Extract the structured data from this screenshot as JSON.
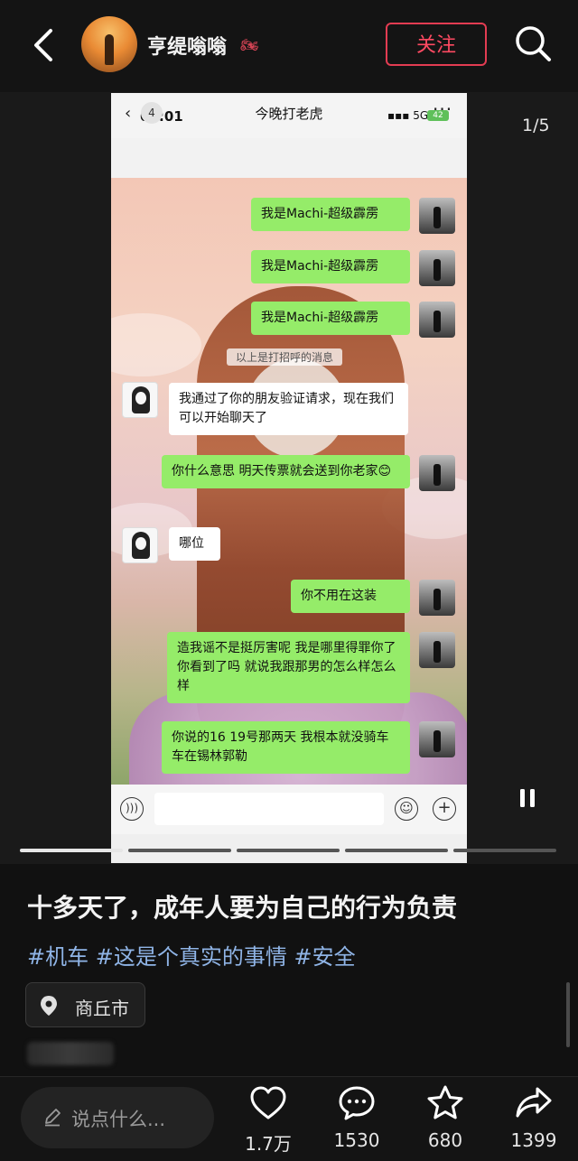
{
  "header": {
    "username": "亨缇嗡嗡",
    "username_emoji": "🏍",
    "follow_label": "关注"
  },
  "media": {
    "page_indicator": "1/5",
    "progress": {
      "total_segments": 5,
      "active_index": 0
    }
  },
  "screenshot": {
    "status_time": "09:01",
    "signal_text": "5G",
    "battery": "42",
    "chat_back_count": "4",
    "chat_title": "今晚打老虎",
    "chat_more": "···",
    "system_message": "以上是打招呼的消息",
    "messages": [
      {
        "side": "right",
        "text": "我是Machi-超级霹雳"
      },
      {
        "side": "right",
        "text": "我是Machi-超级霹雳"
      },
      {
        "side": "right",
        "text": "我是Machi-超级霹雳"
      },
      {
        "side": "left",
        "text": "我通过了你的朋友验证请求，现在我们可以开始聊天了"
      },
      {
        "side": "right",
        "text": "你什么意思  明天传票就会送到你老家😊"
      },
      {
        "side": "left",
        "text": "哪位"
      },
      {
        "side": "right",
        "text": "你不用在这装"
      },
      {
        "side": "right",
        "text": "造我谣不是挺厉害呢   我是哪里得罪你了  你看到了吗 就说我跟那男的怎么样怎么样"
      },
      {
        "side": "right",
        "text": "你说的16  19号那两天  我根本就没骑车  车在锡林郭勒"
      }
    ]
  },
  "post": {
    "title": "十多天了，成年人要为自己的行为负责",
    "tags": "#机车 #这是个真实的事情 #安全",
    "location": "商丘市"
  },
  "bottom": {
    "comment_placeholder": "说点什么...",
    "likes": "1.7万",
    "comments": "1530",
    "stars": "680",
    "shares": "1399"
  },
  "colors": {
    "follow_accent": "#e33c52",
    "tag_blue": "#8fb4e6",
    "bubble_green": "#95ec69"
  },
  "icons": [
    "back-arrow-icon",
    "search-icon",
    "pause-icon",
    "location-pin-icon",
    "pencil-icon",
    "heart-icon",
    "comment-icon",
    "star-icon",
    "share-icon"
  ]
}
